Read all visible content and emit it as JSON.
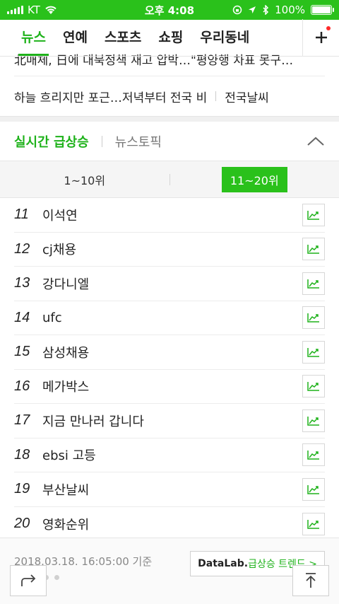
{
  "status": {
    "carrier": "KT",
    "time": "오후 4:08",
    "battery": "100%"
  },
  "tabs": [
    {
      "label": "뉴스"
    },
    {
      "label": "연예"
    },
    {
      "label": "스포츠"
    },
    {
      "label": "쇼핑"
    },
    {
      "label": "우리동네"
    }
  ],
  "headlines": {
    "partial": "北매체, 日에 대북정책 재고 압박…\"평양행 차표 못구…",
    "weather_text": "하늘 흐리지만 포근…저녁부터 전국 비",
    "weather_link": "전국날씨"
  },
  "realtime": {
    "title": "실시간 급상승",
    "topic_tab": "뉴스토픽",
    "range_1": "1~10위",
    "range_2": "11~20위",
    "items": [
      {
        "rank": "11",
        "keyword": "이석연"
      },
      {
        "rank": "12",
        "keyword": "cj채용"
      },
      {
        "rank": "13",
        "keyword": "강다니엘"
      },
      {
        "rank": "14",
        "keyword": "ufc"
      },
      {
        "rank": "15",
        "keyword": "삼성채용"
      },
      {
        "rank": "16",
        "keyword": "메가박스"
      },
      {
        "rank": "17",
        "keyword": "지금 만나러 갑니다"
      },
      {
        "rank": "18",
        "keyword": "ebsi 고등"
      },
      {
        "rank": "19",
        "keyword": "부산날씨"
      },
      {
        "rank": "20",
        "keyword": "영화순위"
      }
    ],
    "timestamp": "2018.03.18. 16:05:00 기준",
    "datalab_brand": "DataLab.",
    "datalab_text": "급상승 트렌드 >"
  },
  "colors": {
    "brand_green": "#1eb21a"
  }
}
